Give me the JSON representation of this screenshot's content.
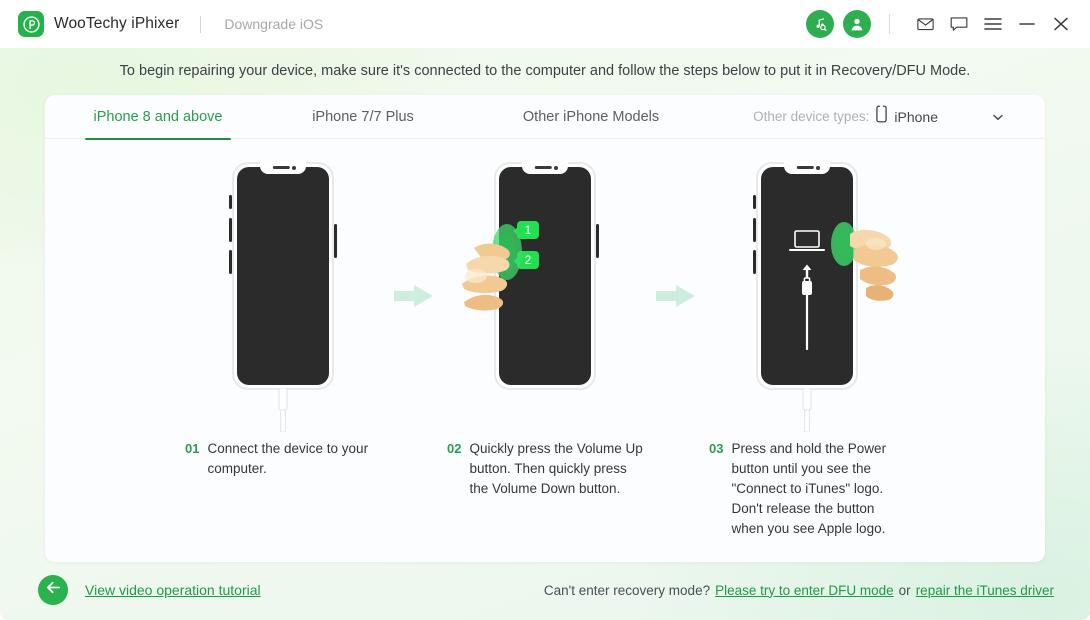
{
  "titlebar": {
    "logo_icon": "wootechy-p-logo-icon",
    "brand": "WooTechy iPhixer",
    "module": "Downgrade iOS",
    "actions": [
      {
        "name": "itunes-search-icon",
        "glyph": "music-search"
      },
      {
        "name": "user-account-icon",
        "glyph": "user"
      },
      {
        "name": "mail-icon",
        "glyph": "envelope"
      },
      {
        "name": "feedback-icon",
        "glyph": "chat-bubble"
      },
      {
        "name": "menu-icon",
        "glyph": "hamburger"
      },
      {
        "name": "minimize-button",
        "glyph": "minus"
      },
      {
        "name": "close-button",
        "glyph": "cross"
      }
    ]
  },
  "intro": "To begin repairing your device, make sure it's connected to the computer and follow the steps below to put it in Recovery/DFU Mode.",
  "tabs": [
    {
      "label": "iPhone 8 and above",
      "active": true
    },
    {
      "label": "iPhone 7/7 Plus",
      "active": false
    },
    {
      "label": "Other iPhone Models",
      "active": false
    }
  ],
  "device_select": {
    "label": "Other device types:",
    "icon": "phone-icon",
    "value": "iPhone",
    "caret": "chevron-down-icon"
  },
  "steps": [
    {
      "num": "01",
      "text": "Connect the device to your computer.",
      "illustration": "iphone-connected-to-cable"
    },
    {
      "num": "02",
      "text": "Quickly press the Volume Up button. Then quickly press the Volume Down button.",
      "illustration": "iphone-hand-pressing-volume-buttons",
      "callouts": [
        "1",
        "2"
      ]
    },
    {
      "num": "03",
      "text": "Press and hold the Power button until you see the \"Connect to iTunes\" logo. Don't release the button when you see Apple logo.",
      "illustration": "iphone-recovery-mode-connect-to-itunes"
    }
  ],
  "arrow_icon": "arrow-right-icon",
  "footer": {
    "back_icon": "arrow-left-icon",
    "tutorial_link": "View video operation tutorial",
    "help_question": "Can't enter recovery mode?",
    "dfu_link": "Please try to enter DFU mode",
    "or": "or",
    "itunes_link": "repair the iTunes driver"
  },
  "colors": {
    "brand_green": "#26b24b",
    "accent_green": "#1f9a45",
    "tab_active": "#2a9d4e",
    "callout_green": "#22e04f",
    "screen_dark": "#2b2b2b",
    "card_bg": "#fcfdff"
  }
}
